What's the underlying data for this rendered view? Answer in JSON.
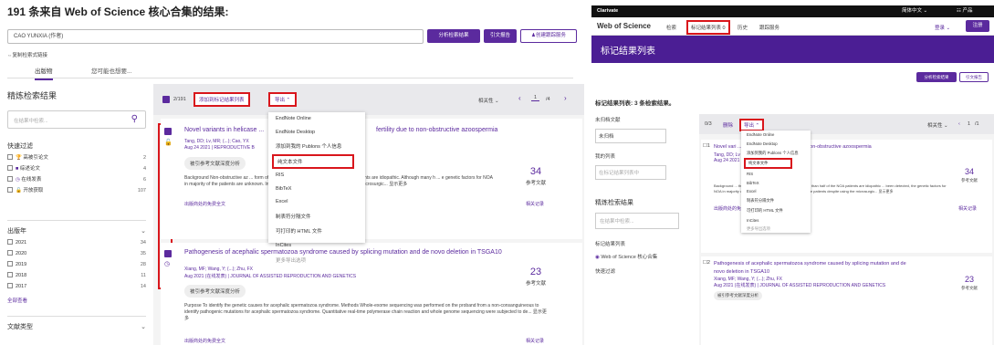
{
  "left": {
    "header": "191 条来自 Web of Science 核心合集的结果:",
    "search_chip": "CAO YUNXIA (作者)",
    "btn_analyze": "分析检索结果",
    "btn_cite": "引文报告",
    "btn_alert": "♟创建跟踪服务",
    "copy_query": "⇔复制检索式链接",
    "tab_pub": "出版物",
    "tab_maybe": "您可能也想要...",
    "refine_title": "精炼检索结果",
    "refine_placeholder": "在结果中检索...",
    "quick_filter": "快速过滤",
    "filters": [
      {
        "label": "高被引论文",
        "count": "2"
      },
      {
        "label": "综述论文",
        "count": "4"
      },
      {
        "label": "在线发表",
        "count": "6"
      },
      {
        "label": "开放获取",
        "count": "107"
      }
    ],
    "year_title": "出版年",
    "years": [
      {
        "y": "2021",
        "c": "34"
      },
      {
        "y": "2020",
        "c": "35"
      },
      {
        "y": "2019",
        "c": "28"
      },
      {
        "y": "2018",
        "c": "11"
      },
      {
        "y": "2017",
        "c": "14"
      }
    ],
    "see_all": "全部查看",
    "doctype": "文献类型",
    "count": "2/191",
    "add_marked": "添加到标记结果列表",
    "export": "导出 ⌃",
    "sort": "相关性 ⌄",
    "page": "1",
    "pages": "/4",
    "menu": [
      "EndNote Online",
      "EndNote Desktop",
      "添加到我的 Publons 个人信息",
      "纯文本文件",
      "RIS",
      "BibTeX",
      "Excel",
      "制表符分隔文件",
      "可打印的 HTML 文件",
      "InCites",
      "更多导出选项"
    ],
    "r1": {
      "title": "Novel variants in helicase ...",
      "title_tail": "fertility due to non-obstructive azoospermia",
      "authors": "Tang, DD; Lv, MR; (...); Cao, YX",
      "date": "Aug 24 2021 | REPRODUCTIVE B",
      "cnt": "34",
      "cnt_label": "参考文献",
      "ref_btn": "被引参考文献深度分析",
      "abstract": "Background Non-obstructive az ... form of male infertility; more than half of the NOA patients are idiopathic. Although many h ... e genetic factors for NOA in majority of the patients are unknown. In addition, it is diffic ... dents despite using the microsurgic... 显示更多",
      "fulltext": "出版商处的免费全文",
      "rec": "相关记录"
    },
    "r2": {
      "title": "Pathogenesis of acephalic spermatozoa syndrome caused by splicing mutation and de novo deletion in TSGA10",
      "authors": "Xiang, MF; Wang, Y; (...); Zhu, FX",
      "date": "Aug 2021 (在线发表) | JOURNAL OF ASSISTED REPRODUCTION AND GENETICS",
      "cnt": "23",
      "cnt_label": "参考文献",
      "ref_btn": "被引参考文献深度分析",
      "abstract": "Purpose To identify the genetic causes for acephalic spermatozoa syndrome. Methods Whole-exome sequencing was performed on the proband from a non-consanguineous to identify pathogenic mutations for acephalic spermatozoa syndrome. Quantitative real-time polymerase chain reaction and whole genome sequencing were subjected to de... 显示更多",
      "fulltext": "出版商处的免费全文",
      "rec": "相关记录"
    }
  },
  "right": {
    "brand": "Clarivate",
    "lang": "简体中文 ⌄",
    "products": "☷ 产品",
    "logo": "Web of Science",
    "nav": [
      "检索",
      "标记结果列表 0",
      "历史",
      "跟踪服务"
    ],
    "login": "登录 ⌄",
    "register": "注册",
    "banner": "标记结果列表",
    "subtitle": "标记结果列表: 3 条检索结果。",
    "btn1": "分析检索结果",
    "btn2": "引文报告",
    "unsorted": "未归档文献",
    "unsorted_sel": "未归档",
    "my_list": "我的列表",
    "list_ph": "在标记结果列表中",
    "refine": "精炼检索结果",
    "refine_ph": "在结果中检索...",
    "db_title": "标记结果列表",
    "db": "Web of Science 核心合集",
    "quick": "快速过滤",
    "count": "0/3",
    "del": "删除",
    "export": "导出 ⌃",
    "sort": "相关性 ⌄",
    "page": "1",
    "pages": "/1",
    "menu": [
      "EndNote Online",
      "EndNote Desktop",
      "添加到我的 Publons 个人信息",
      "纯文本文件",
      "RIS",
      "BibTeX",
      "Excel",
      "制表符分隔文件",
      "可打印的 HTML 文件",
      "InCites",
      "更多导出选项"
    ],
    "r1": {
      "title": "Novel vari ... lead to male infertility due to non-obstructive azoospermia",
      "authors": "Tang, DD; Lv",
      "date": "Aug 24 2021 | REP ... OLOGY 19(1)",
      "cnt": "34",
      "cnt_label": "参考文献",
      "abstract": "Background ... the most severe form of male infertility; more than half of the NOA patients are idiopathic ... been detected, the genetic factors for NOA in majority of the patients are unknown. In ... from these patients despite using the microsurgic... 显示更多",
      "fulltext": "出版商处的免费全文",
      "rec": "相关记录"
    },
    "r2": {
      "title": "Pathogenesis of acephalic spermatozoa syndrome caused by splicing mutation and de novo deletion in TSGA10",
      "authors": "Xiang, MF; Wang, Y; (...); Zhu, FX",
      "date": "Aug 2021 (在线发表) | JOURNAL OF ASSISTED REPRODUCTION AND GENETICS",
      "cnt": "23",
      "cnt_label": "参考文献",
      "ref_btn": "被引参考文献深度分析"
    }
  },
  "colors": {
    "accent": "#5b2a9e",
    "highlight": "#d9161c"
  }
}
